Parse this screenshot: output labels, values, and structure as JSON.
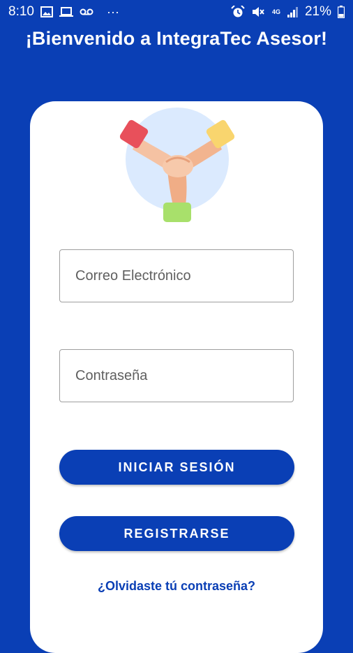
{
  "status_bar": {
    "time": "8:10",
    "left_icons": [
      "image-icon",
      "laptop-icon",
      "voicemail-icon",
      "more-dots-icon"
    ],
    "more": "···",
    "network": "4G",
    "battery": "21%",
    "right_icons": [
      "alarm-icon",
      "mute-icon",
      "signal-icon",
      "battery-icon"
    ]
  },
  "header": {
    "title": "¡Bienvenido a IntegraTec Asesor!"
  },
  "form": {
    "email_placeholder": "Correo Electrónico",
    "password_placeholder": "Contraseña",
    "login_label": "INICIAR SESIÓN",
    "register_label": "REGISTRARSE",
    "forgot_label": "¿Olvidaste tú contraseña?"
  },
  "colors": {
    "primary": "#0a3fb5",
    "card": "#ffffff",
    "logo_red": "#e8505b",
    "logo_yellow": "#f9d56e",
    "logo_green": "#a8e06b",
    "logo_circle": "#dbeafe"
  }
}
